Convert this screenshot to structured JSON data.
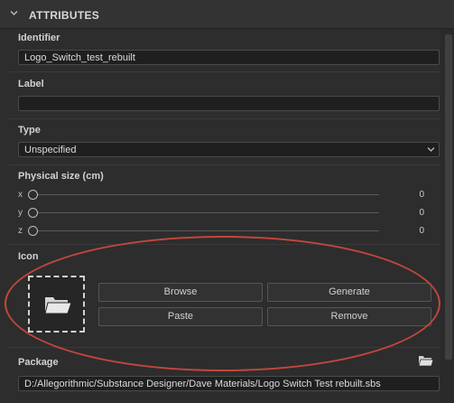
{
  "panel": {
    "title": "ATTRIBUTES",
    "collapse_icon": "chevron-down-icon"
  },
  "identifier": {
    "label": "Identifier",
    "value": "Logo_Switch_test_rebuilt"
  },
  "label_field": {
    "label": "Label",
    "value": ""
  },
  "type": {
    "label": "Type",
    "value": "Unspecified",
    "icon": "chevron-down-icon"
  },
  "physical_size": {
    "label": "Physical size (cm)",
    "axes": [
      {
        "axis": "x",
        "value": "0"
      },
      {
        "axis": "y",
        "value": "0"
      },
      {
        "axis": "z",
        "value": "0"
      }
    ]
  },
  "icon": {
    "label": "Icon",
    "placeholder_icon": "folder-open-icon",
    "buttons": {
      "browse": "Browse",
      "generate": "Generate",
      "paste": "Paste",
      "remove": "Remove"
    }
  },
  "package": {
    "label": "Package",
    "value": "D:/Allegorithmic/Substance Designer/Dave Materials/Logo Switch Test rebuilt.sbs",
    "icon": "folder-open-icon"
  },
  "colors": {
    "highlight": "#c4463c",
    "background": "#2d2d2d",
    "field": "#1f1f1f"
  }
}
